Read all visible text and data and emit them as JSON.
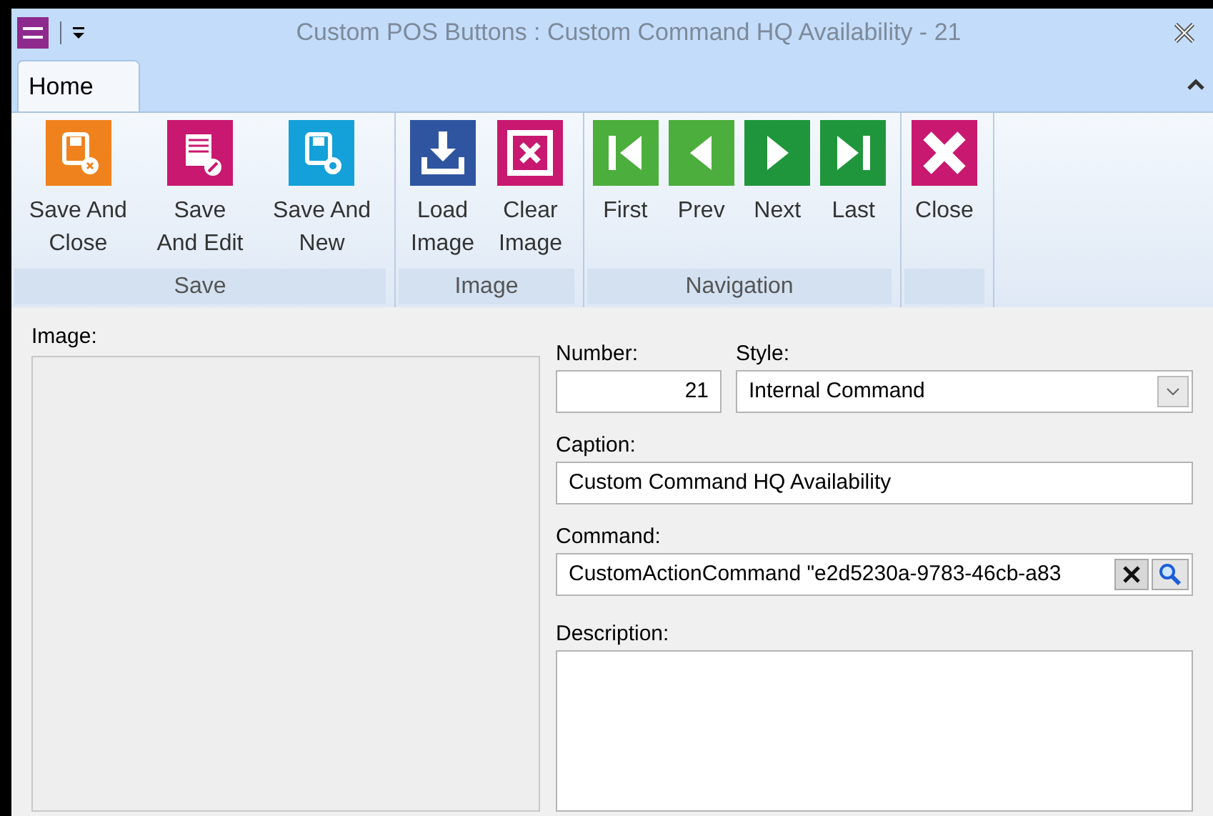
{
  "window": {
    "title": "Custom POS Buttons : Custom Command HQ Availability - 21"
  },
  "tabs": [
    {
      "label": "Home",
      "selected": true
    }
  ],
  "ribbon": {
    "groups": [
      {
        "label": "Save",
        "buttons": [
          {
            "kind": "saveclose",
            "lines": [
              "Save And",
              "Close"
            ]
          },
          {
            "kind": "saveedit",
            "lines": [
              "Save",
              "And Edit"
            ]
          },
          {
            "kind": "savenew",
            "lines": [
              "Save And",
              "New"
            ]
          }
        ]
      },
      {
        "label": "Image",
        "buttons": [
          {
            "kind": "load",
            "lines": [
              "Load",
              "Image"
            ]
          },
          {
            "kind": "clear",
            "lines": [
              "Clear",
              "Image"
            ]
          }
        ]
      },
      {
        "label": "Navigation",
        "buttons": [
          {
            "kind": "first",
            "lines": [
              "First"
            ]
          },
          {
            "kind": "prev",
            "lines": [
              "Prev"
            ]
          },
          {
            "kind": "next",
            "lines": [
              "Next"
            ]
          },
          {
            "kind": "last",
            "lines": [
              "Last"
            ]
          }
        ]
      },
      {
        "buttons": [
          {
            "kind": "close",
            "lines": [
              "Close"
            ]
          }
        ]
      }
    ]
  },
  "form": {
    "image_label": "Image:",
    "number": {
      "label": "Number:",
      "value": "21"
    },
    "style": {
      "label": "Style:",
      "value": "Internal Command"
    },
    "caption": {
      "label": "Caption:",
      "value": "Custom Command HQ Availability"
    },
    "command": {
      "label": "Command:",
      "value": "CustomActionCommand \"e2d5230a-9783-46cb-a83"
    },
    "description": {
      "label": "Description:"
    }
  }
}
